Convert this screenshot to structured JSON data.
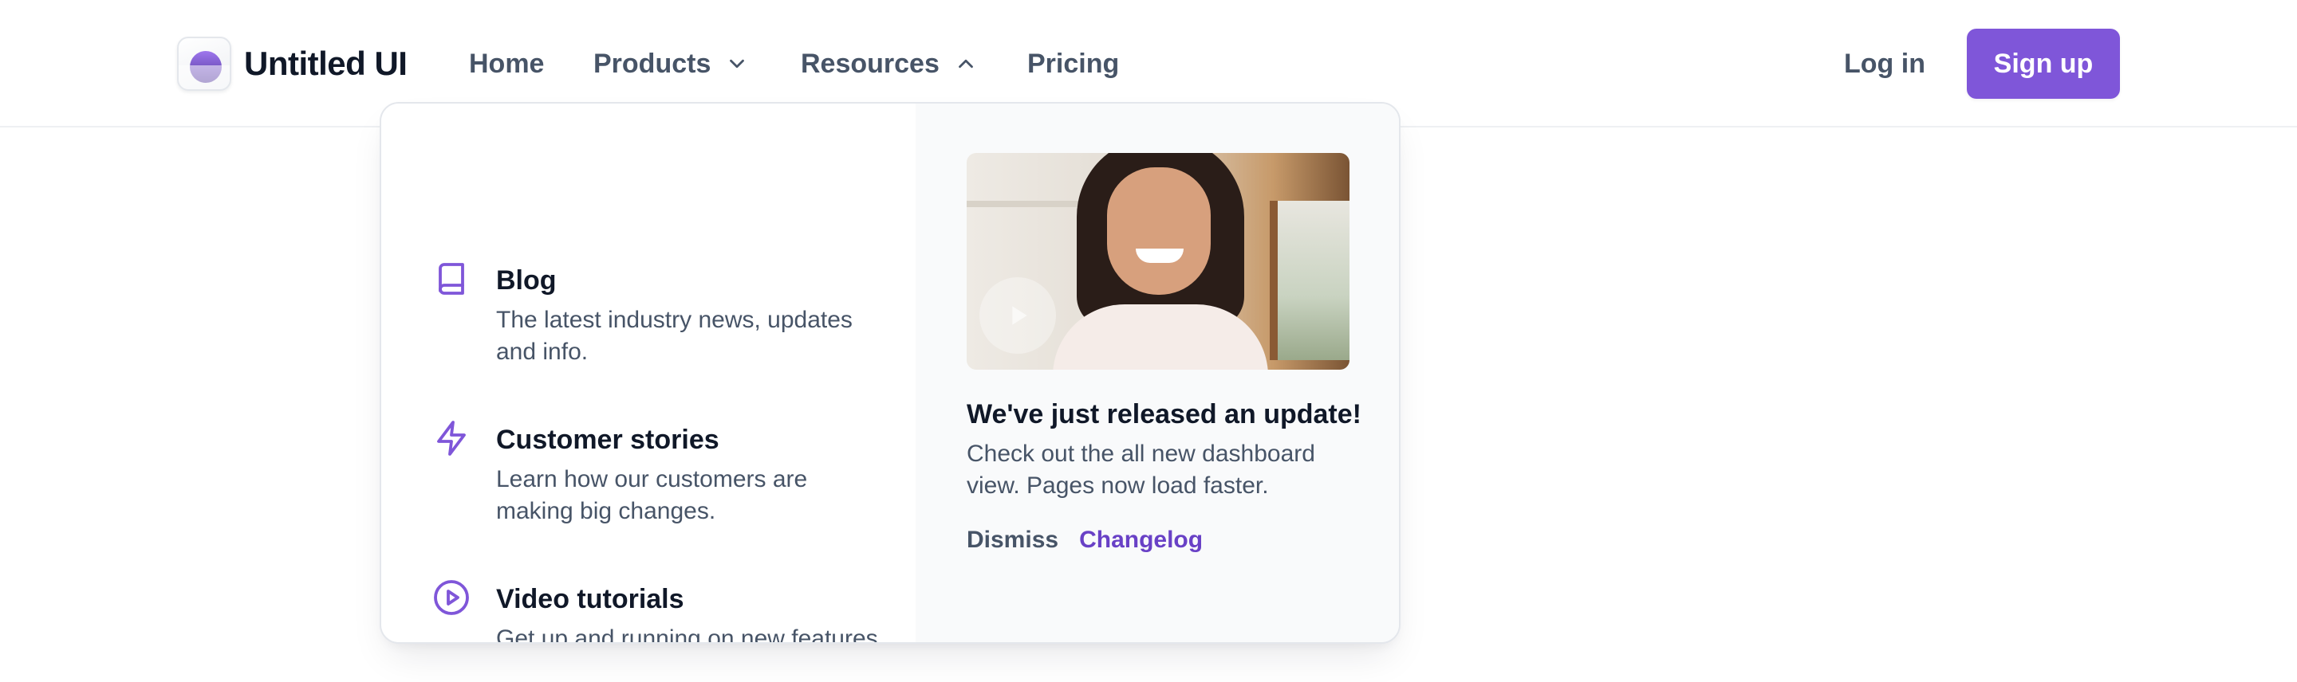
{
  "brand": {
    "name": "Untitled UI",
    "icon": "untitled-ui-logo-icon",
    "accent_color": "#7f56d9"
  },
  "nav": {
    "items": [
      {
        "label": "Home"
      },
      {
        "label": "Products",
        "icon": "chevron-down-icon"
      },
      {
        "label": "Resources",
        "icon": "chevron-up-icon"
      },
      {
        "label": "Pricing"
      }
    ]
  },
  "auth": {
    "login_label": "Log in",
    "signup_label": "Sign up"
  },
  "resources_menu": {
    "links": [
      {
        "icon": "book-icon",
        "title": "Blog",
        "description": "The latest industry news, updates and info."
      },
      {
        "icon": "zap-icon",
        "title": "Customer stories",
        "description": "Learn how our customers are making big changes."
      },
      {
        "icon": "play-circle-icon",
        "title": "Video tutorials",
        "description": "Get up and running on new features and techniques."
      }
    ],
    "promo": {
      "title": "We've just released an update!",
      "description": "Check out the all new dashboard view. Pages now load faster.",
      "dismiss_label": "Dismiss",
      "changelog_label": "Changelog"
    }
  }
}
